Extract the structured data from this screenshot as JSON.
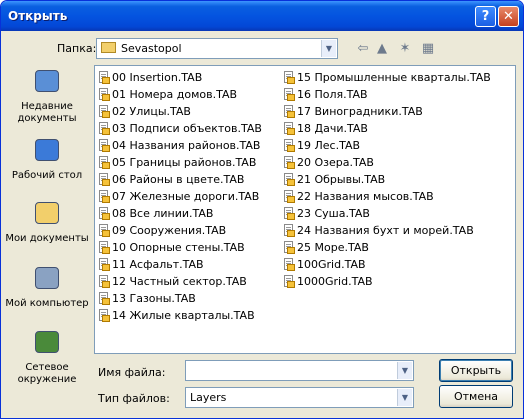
{
  "window": {
    "title": "Открыть",
    "help_glyph": "?",
    "close_glyph": "✕"
  },
  "lookin": {
    "label": "Папка:",
    "value": "Sevastopol"
  },
  "toolbar": [
    {
      "name": "back-icon",
      "glyph": "⇦"
    },
    {
      "name": "up-folder-icon",
      "glyph": "▲"
    },
    {
      "name": "new-folder-icon",
      "glyph": "✶"
    },
    {
      "name": "view-menu-icon",
      "glyph": "▦"
    }
  ],
  "places": [
    {
      "label": "Недавние документы",
      "icon": "recent-documents-icon"
    },
    {
      "label": "Рабочий стол",
      "icon": "desktop-icon"
    },
    {
      "label": "Мои документы",
      "icon": "my-documents-icon"
    },
    {
      "label": "Мой компьютер",
      "icon": "my-computer-icon"
    },
    {
      "label": "Сетевое окружение",
      "icon": "network-icon"
    }
  ],
  "files": [
    [
      "00 Insertion.TAB",
      "01 Номера домов.TAB",
      "02 Улицы.TAB",
      "03 Подписи объектов.TAB",
      "04 Названия районов.TAB",
      "05 Границы районов.TAB",
      "06 Районы в цвете.TAB",
      "07 Железные дороги.TAB",
      "08 Все линии.TAB",
      "09 Сооружения.TAB",
      "10 Опорные стены.TAB",
      "11 Асфальт.TAB",
      "12 Частный сектор.TAB",
      "13 Газоны.TAB",
      "14 Жилые кварталы.TAB"
    ],
    [
      "15 Промышленные кварталы.TAB",
      "16 Поля.TAB",
      "17 Виноградники.TAB",
      "18 Дачи.TAB",
      "19 Лес.TAB",
      "20 Озера.TAB",
      "21 Обрывы.TAB",
      "22 Названия мысов.TAB",
      "23 Суша.TAB",
      "24 Названия бухт и морей.TAB",
      "25 Море.TAB",
      "100Grid.TAB",
      "1000Grid.TAB"
    ]
  ],
  "filename": {
    "label": "Имя файла:",
    "value": ""
  },
  "filetype": {
    "label": "Тип файлов:",
    "value": "Layers"
  },
  "buttons": {
    "open": "Открыть",
    "cancel": "Отмена"
  },
  "colors": {
    "titlebar": "#0454e0",
    "dialog_bg": "#ece9d8",
    "field_border": "#7f9db9"
  }
}
